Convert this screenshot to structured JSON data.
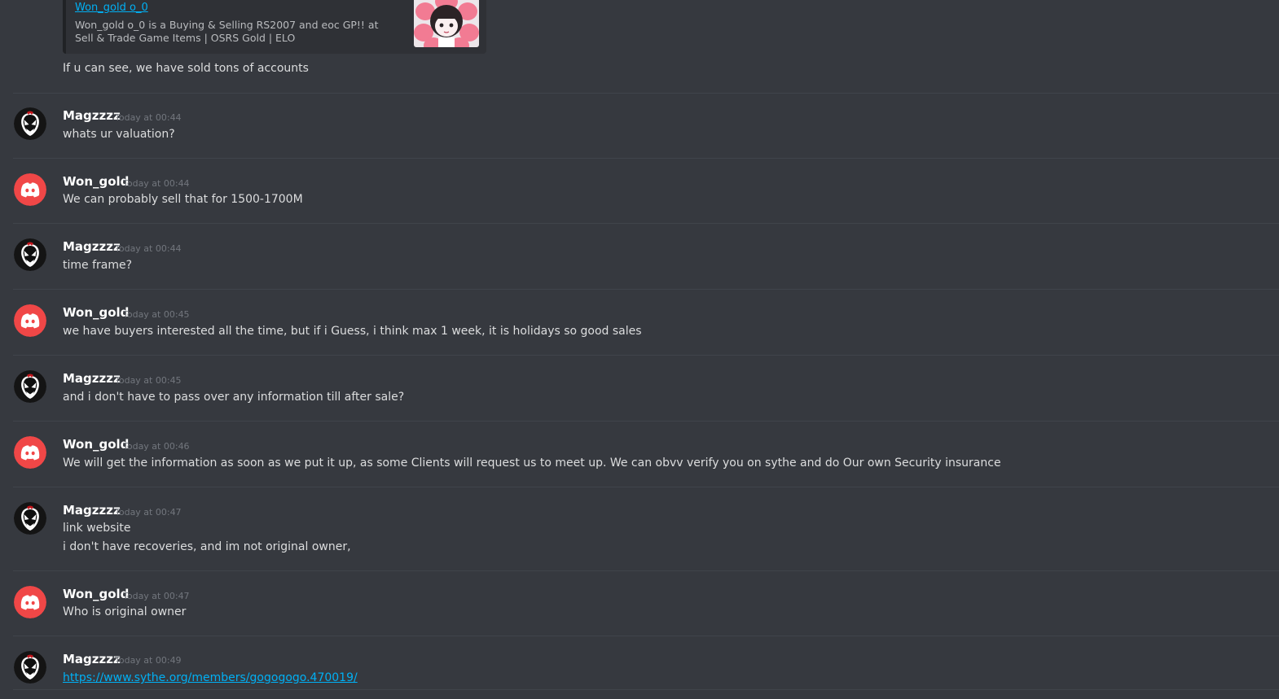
{
  "embed": {
    "author": "Won_gold o_0",
    "description": "Won_gold o_0 is a Buying & Selling RS2007 and eoc GP!! at Sell & Trade Game Items | OSRS Gold | ELO",
    "thumbnail_icon": "anime-girl-flower-thumbnail"
  },
  "continuation_text": "If u can see, we have sold tons of accounts",
  "messages": [
    {
      "author": "Magzzzz",
      "avatar_icon": "venom-avatar",
      "timestamp": "Today at 00:44",
      "lines": [
        "whats ur valuation?"
      ]
    },
    {
      "author": "Won_gold",
      "avatar_icon": "discord-logo-avatar",
      "timestamp": "Today at 00:44",
      "lines": [
        "We can probably sell that for 1500-1700M"
      ]
    },
    {
      "author": "Magzzzz",
      "avatar_icon": "venom-avatar",
      "timestamp": "Today at 00:44",
      "lines": [
        "time frame?"
      ]
    },
    {
      "author": "Won_gold",
      "avatar_icon": "discord-logo-avatar",
      "timestamp": "Today at 00:45",
      "lines": [
        "we have buyers interested all the time, but if i Guess, i think max 1 week, it is holidays so good sales"
      ]
    },
    {
      "author": "Magzzzz",
      "avatar_icon": "venom-avatar",
      "timestamp": "Today at 00:45",
      "lines": [
        "and i don't have to pass over any information till after sale?"
      ]
    },
    {
      "author": "Won_gold",
      "avatar_icon": "discord-logo-avatar",
      "timestamp": "Today at 00:46",
      "lines": [
        "We will get the information as soon as we put it up, as some Clients will request us to meet up. We can obvv verify you on sythe and do Our own Security insurance"
      ]
    },
    {
      "author": "Magzzzz",
      "avatar_icon": "venom-avatar",
      "timestamp": "Today at 00:47",
      "lines": [
        "link website",
        "i don't have recoveries, and im not original owner,"
      ]
    },
    {
      "author": "Won_gold",
      "avatar_icon": "discord-logo-avatar",
      "timestamp": "Today at 00:47",
      "lines": [
        "Who is original owner"
      ]
    },
    {
      "author": "Magzzzz",
      "avatar_icon": "venom-avatar",
      "timestamp": "Today at 00:49",
      "link": "https://www.sythe.org/members/gogogogo.470019/"
    }
  ],
  "colors": {
    "background": "#36393f",
    "link": "#00b0f4",
    "discord_avatar": "#f04747",
    "text": "#dcddde",
    "timestamp": "#72767d"
  }
}
